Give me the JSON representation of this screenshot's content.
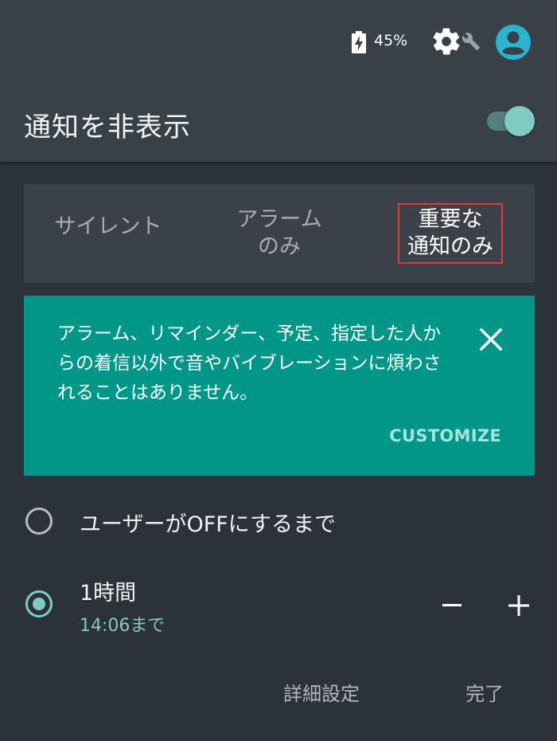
{
  "status_bar": {
    "battery_percent": "45%",
    "icons": [
      "battery-charging-icon",
      "gear-icon",
      "wrench-icon",
      "account-circle-icon"
    ]
  },
  "header": {
    "title": "通知を非表示",
    "toggle_on": true
  },
  "segments": [
    {
      "label": "サイレント",
      "selected": false
    },
    {
      "label": "アラーム\nのみ",
      "selected": false
    },
    {
      "label": "重要な\n通知のみ",
      "selected": true
    }
  ],
  "info_card": {
    "text": "アラーム、リマインダー、予定、指定した人からの着信以外で音やバイブレーションに煩わされることはありません。",
    "action": "CUSTOMIZE"
  },
  "options": {
    "until_off": {
      "label": "ユーザーがOFFにするまで",
      "selected": false
    },
    "one_hour": {
      "label": "1時間",
      "sub": "14:06まで",
      "selected": true
    }
  },
  "buttons": {
    "details": "詳細設定",
    "done": "完了"
  },
  "colors": {
    "panel": "#384048",
    "background": "#2b323a",
    "accent": "#80cbc4",
    "card": "#009688",
    "avatar": "#26b6cf"
  }
}
